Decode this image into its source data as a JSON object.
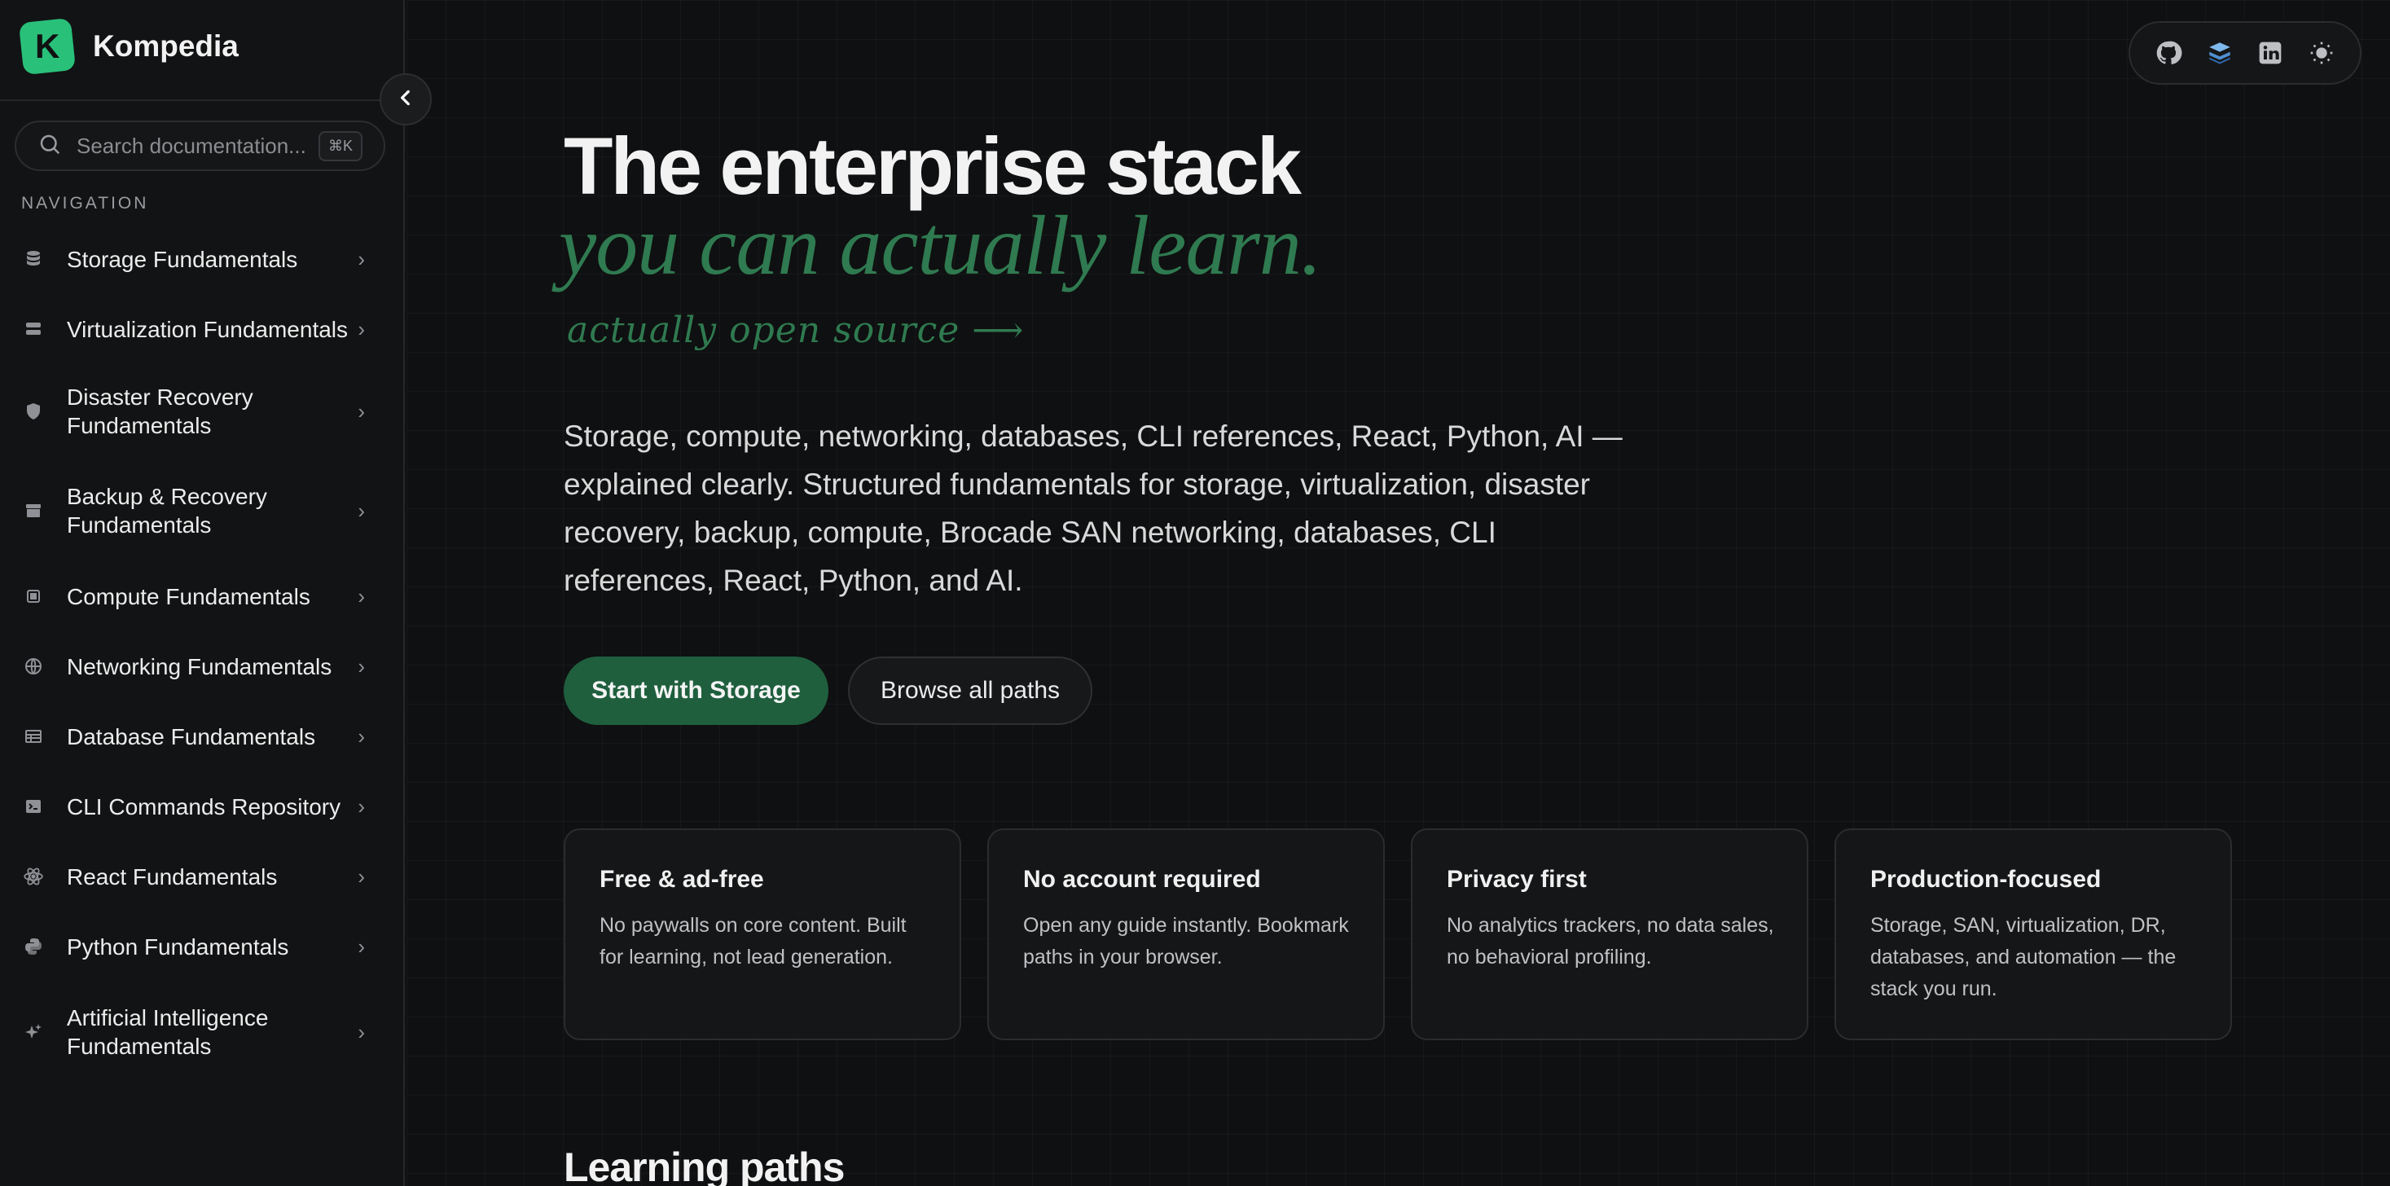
{
  "brand": {
    "logo_letter": "K",
    "name": "Kompedia",
    "accent": "#29c07a"
  },
  "search": {
    "placeholder": "Search documentation...",
    "shortcut": "⌘K"
  },
  "sidebar": {
    "section_label": "NAVIGATION",
    "items": [
      {
        "label": "Storage Fundamentals",
        "icon": "database-icon"
      },
      {
        "label": "Virtualization Fundamentals",
        "icon": "server-stack-icon"
      },
      {
        "label": "Disaster Recovery Fundamentals",
        "icon": "shield-icon"
      },
      {
        "label": "Backup & Recovery Fundamentals",
        "icon": "archive-icon"
      },
      {
        "label": "Compute Fundamentals",
        "icon": "cpu-icon"
      },
      {
        "label": "Networking Fundamentals",
        "icon": "globe-icon"
      },
      {
        "label": "Database Fundamentals",
        "icon": "table-icon"
      },
      {
        "label": "CLI Commands Repository",
        "icon": "terminal-icon"
      },
      {
        "label": "React Fundamentals",
        "icon": "react-atom-icon"
      },
      {
        "label": "Python Fundamentals",
        "icon": "python-icon"
      },
      {
        "label": "Artificial Intelligence Fundamentals",
        "icon": "sparkles-icon"
      }
    ]
  },
  "topbar": {
    "icons": [
      "github-icon",
      "layers-icon",
      "linkedin-icon",
      "sun-icon"
    ]
  },
  "hero": {
    "title": "The enterprise stack",
    "subtitle": "you can actually learn.",
    "note": "actually open source",
    "note_arrow": "⟶",
    "description": "Storage, compute, networking, databases, CLI references, React, Python, AI — explained clearly. Structured fundamentals for storage, virtualization, disaster recovery, backup, compute, Brocade SAN networking, databases, CLI references, React, Python, and AI.",
    "primary_button": "Start with Storage",
    "secondary_button": "Browse all paths"
  },
  "features": [
    {
      "title": "Free & ad-free",
      "description": "No paywalls on core content. Built for learning, not lead generation."
    },
    {
      "title": "No account required",
      "description": "Open any guide instantly. Bookmark paths in your browser."
    },
    {
      "title": "Privacy first",
      "description": "No analytics trackers, no data sales, no behavioral profiling."
    },
    {
      "title": "Production-focused",
      "description": "Storage, SAN, virtualization, DR, databases, and automation — the stack you run."
    }
  ],
  "section": {
    "heading": "Learning paths"
  },
  "colors": {
    "background": "#0f1011",
    "accent_green": "#2f7a50",
    "button_green": "#1f5f3e"
  }
}
